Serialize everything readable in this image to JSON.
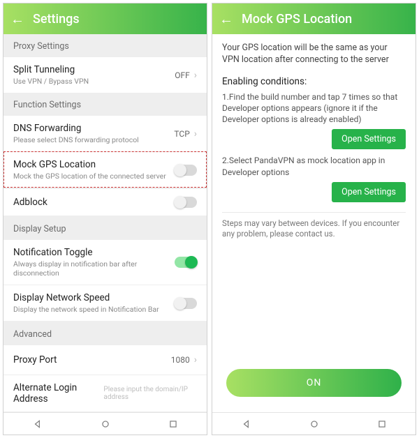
{
  "left": {
    "title": "Settings",
    "sections": {
      "proxy": "Proxy Settings",
      "func": "Function Settings",
      "display": "Display Setup",
      "advanced": "Advanced"
    },
    "rows": {
      "split": {
        "t": "Split Tunneling",
        "s": "Use VPN / Bypass VPN",
        "v": "OFF"
      },
      "dns": {
        "t": "DNS Forwarding",
        "s": "Please select DNS forwarding protocol",
        "v": "TCP"
      },
      "mock": {
        "t": "Mock GPS Location",
        "s": "Mock the GPS location of the connected server"
      },
      "adblock": {
        "t": "Adblock"
      },
      "notif": {
        "t": "Notification Toggle",
        "s": "Always display in notification bar after disconnection"
      },
      "speed": {
        "t": "Display Network Speed",
        "s": "Display the network speed in Notification Bar"
      },
      "port": {
        "t": "Proxy Port",
        "v": "1080"
      },
      "alt": {
        "t": "Alternate Login Address",
        "ph": "Please input the domain/IP address"
      }
    }
  },
  "right": {
    "title": "Mock GPS Location",
    "intro": "Your GPS location will be the same as your VPN location after connecting to the server",
    "cond_h": "Enabling conditions:",
    "step1": "1.Find the build number and tap 7 times so that Developer options appears (ignore it if the Developer options is already enabled)",
    "step2": "2.Select PandaVPN as mock location app in Developer options",
    "open": "Open Settings",
    "note": "Steps may vary between devices. If you encounter any problem, please contact us.",
    "on": "ON"
  }
}
